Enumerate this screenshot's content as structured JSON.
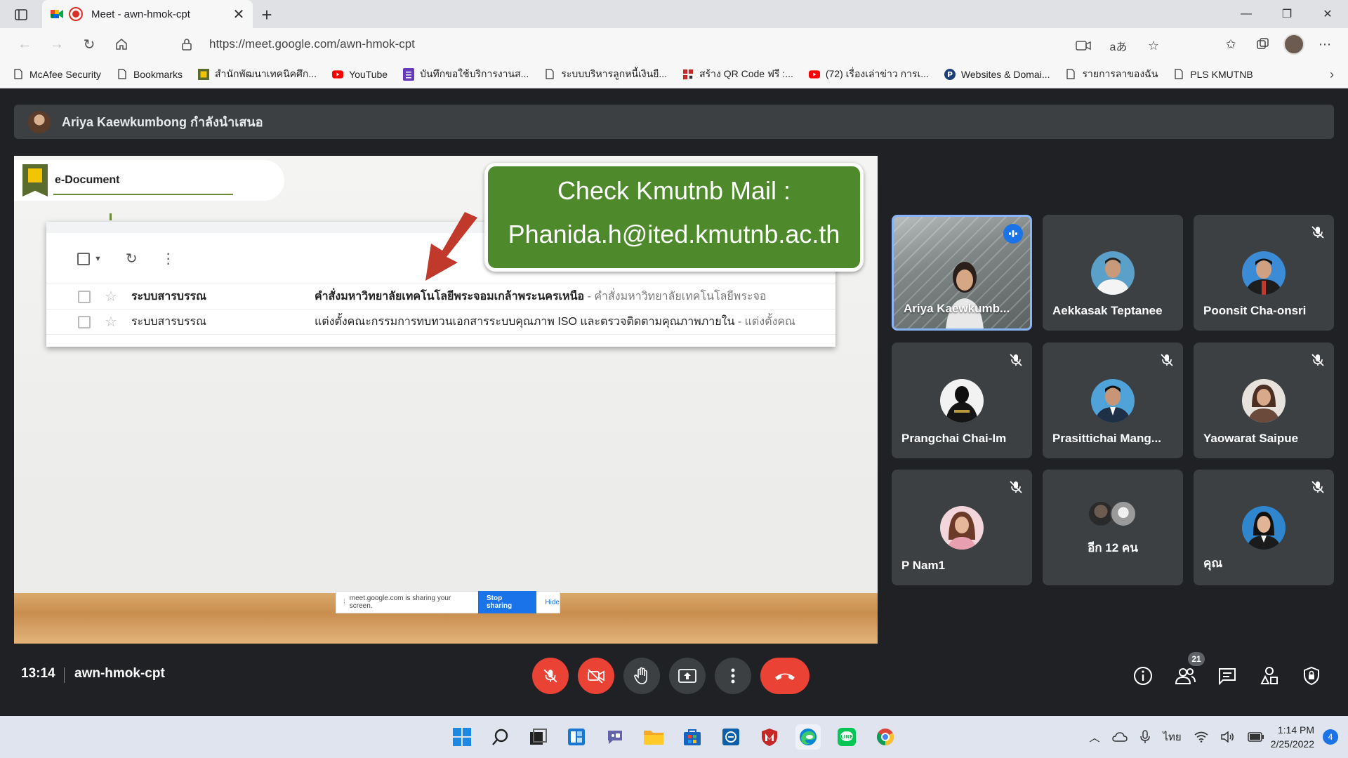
{
  "browser": {
    "tab_title": "Meet - awn-hmok-cpt",
    "url": "https://meet.google.com/awn-hmok-cpt",
    "bookmarks": [
      {
        "label": "McAfee Security",
        "icon": "page-icon"
      },
      {
        "label": "Bookmarks",
        "icon": "page-icon"
      },
      {
        "label": "สำนักพัฒนาเทคนิคศึก...",
        "icon": "ited-logo-icon"
      },
      {
        "label": "YouTube",
        "icon": "youtube-icon"
      },
      {
        "label": "บันทึกขอใช้บริการงานส...",
        "icon": "form-icon"
      },
      {
        "label": "ระบบบริหารลูกหนี้เงินยื...",
        "icon": "page-icon"
      },
      {
        "label": "สร้าง QR Code ฟรี :...",
        "icon": "qr-icon"
      },
      {
        "label": "(72) เรื่องเล่าข่าว การเ...",
        "icon": "youtube-icon"
      },
      {
        "label": "Websites & Domai...",
        "icon": "p-icon"
      },
      {
        "label": "รายการลาของฉัน",
        "icon": "page-icon"
      },
      {
        "label": "PLS KMUTNB",
        "icon": "page-icon"
      }
    ]
  },
  "meet": {
    "presenter_banner": "Ariya Kaewkumbong กำลังนำเสนอ",
    "meeting_time": "13:14",
    "meeting_code": "awn-hmok-cpt",
    "participant_count": "21",
    "presentation": {
      "edoc_title": "e-Document",
      "callout_line1": "Check Kmutnb Mail :",
      "callout_line2": "Phanida.h@ited.kmutnb.ac.th",
      "mail_rows": [
        {
          "from": "ระบบสารบรรณ",
          "subject": "คำสั่งมหาวิทยาลัยเทคโนโลยีพระจอมเกล้าพระนครเหนือ",
          "snippet": " - คำสั่งมหาวิทยาลัยเทคโนโลยีพระจอ"
        },
        {
          "from": "ระบบสารบรรณ",
          "subject": "แต่งตั้งคณะกรรมการทบทวนเอกสารระบบคุณภาพ ISO และตรวจติดตามคุณภาพภายใน",
          "snippet": " - แต่งตั้งคณ"
        }
      ],
      "share_notice": "meet.google.com is sharing your screen.",
      "stop_sharing": "Stop sharing",
      "hide": "Hide"
    },
    "participants": [
      {
        "name": "Ariya Kaewkumb...",
        "speaking": true,
        "muted": false
      },
      {
        "name": "Aekkasak Teptanee",
        "muted": false
      },
      {
        "name": "Poonsit Cha-onsri",
        "muted": true
      },
      {
        "name": "Prangchai Chai-Im",
        "muted": true
      },
      {
        "name": "Prasittichai Mang...",
        "muted": true
      },
      {
        "name": "Yaowarat Saipue",
        "muted": true
      },
      {
        "name": "P Nam1",
        "muted": true
      },
      {
        "name": "อีก 12 คน",
        "muted": false
      },
      {
        "name": "คุณ",
        "muted": true
      }
    ]
  },
  "taskbar": {
    "language": "ไทย",
    "time": "1:14 PM",
    "date": "2/25/2022",
    "notifications": "4"
  },
  "colors": {
    "meet_bg": "#202124",
    "tile_bg": "#3c4043",
    "danger": "#ea4335",
    "accent": "#1a73e8",
    "callout_green": "#4e8a2c"
  }
}
